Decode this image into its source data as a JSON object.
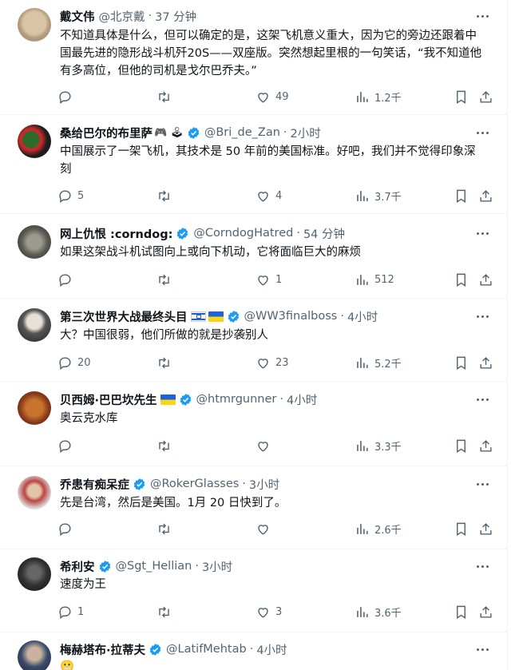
{
  "tweets": [
    {
      "name": "戴文伟",
      "handle": "@北京戴",
      "time": "37 分钟",
      "verified": false,
      "text": "不知道具体是什么，但可以确定的是，这架飞机意义重大，因为它的旁边还跟着中国最先进的隐形战斗机歼20S——双座版。突然想起里根的一句笑话，“我不知道他有多高位，但他的司机是戈尔巴乔夫。”",
      "replies": "",
      "retweets": "",
      "likes": "49",
      "views": "1.2千"
    },
    {
      "name": "桑给巴尔的布里萨",
      "name_emoji": "🎮 🕹",
      "handle": "@Bri_de_Zan",
      "time": "2小时",
      "verified": true,
      "text": "中国展示了一架飞机，其技术是 50 年前的美国标准。好吧，我们并不觉得印象深刻",
      "replies": "5",
      "retweets": "",
      "likes": "4",
      "views": "3.7千"
    },
    {
      "name": "网上仇恨 :corndog:",
      "handle": "@CorndogHatred",
      "time": "54 分钟",
      "verified": true,
      "text": "如果这架战斗机试图向上或向下机动，它将面临巨大的麻烦",
      "replies": "",
      "retweets": "",
      "likes": "1",
      "views": "512"
    },
    {
      "name": "第三次世界大战最终头目",
      "flags": [
        "israel-flag",
        "ukraine-flag"
      ],
      "handle": "@WW3finalboss",
      "time": "4小时",
      "verified": true,
      "text": "大？中国很弱，他们所做的就是抄袭别人",
      "replies": "20",
      "retweets": "",
      "likes": "23",
      "views": "5.2千"
    },
    {
      "name": "贝西姆·巴巴坎先生",
      "flags": [
        "ukraine-flag"
      ],
      "handle": "@htmrgunner",
      "time": "4小时",
      "verified": true,
      "text": "奥云克水库",
      "replies": "",
      "retweets": "",
      "likes": "",
      "views": "3.3千"
    },
    {
      "name": "乔患有痴呆症",
      "handle": "@RokerGlasses",
      "time": "3小时",
      "verified": true,
      "text": "先是台湾，然后是美国。1月 20 日快到了。",
      "replies": "",
      "retweets": "",
      "likes": "",
      "views": "2.6千"
    },
    {
      "name": "希利安",
      "handle": "@Sgt_Hellian",
      "time": "3小时",
      "verified": true,
      "text": "速度为王",
      "replies": "1",
      "retweets": "",
      "likes": "3",
      "views": "3.6千"
    },
    {
      "name": "梅赫塔布·拉蒂夫",
      "handle": "@LatifMehtab",
      "time": "4小时",
      "verified": true,
      "text": "😬",
      "replies": "",
      "retweets": "",
      "likes": "",
      "views": ""
    }
  ],
  "colors": {
    "verified": "#1d9bf0",
    "muted": "#536471",
    "text": "#0f1419",
    "divider": "#eff3f4"
  },
  "icons": [
    "reply-icon",
    "retweet-icon",
    "like-icon",
    "views-icon",
    "bookmark-icon",
    "share-icon",
    "more-icon",
    "verified-badge-icon"
  ]
}
